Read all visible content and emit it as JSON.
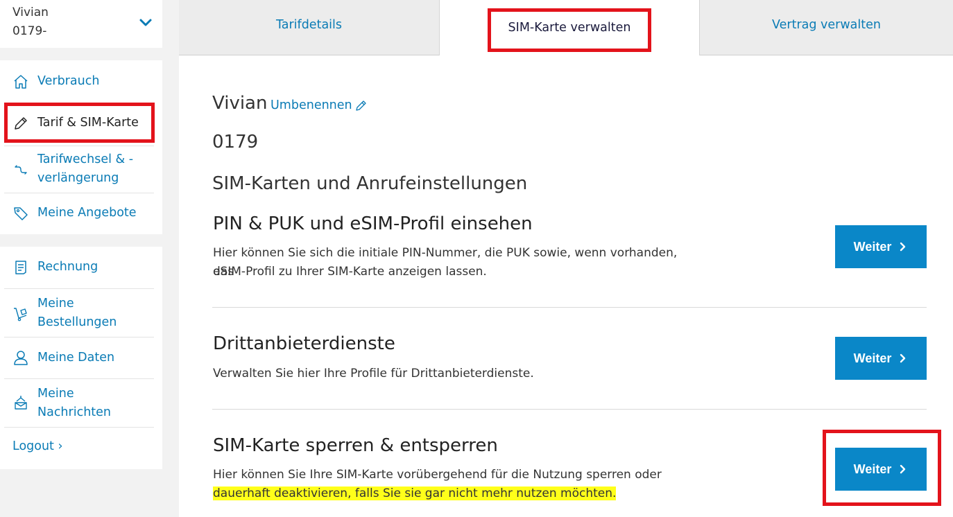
{
  "account": {
    "name": "Vivian",
    "number": "0179-"
  },
  "sidebar": {
    "group1": [
      {
        "label": "Verbrauch",
        "icon": "home-icon"
      },
      {
        "label": "Tarif & SIM-Karte",
        "icon": "pencil-icon",
        "active": true
      },
      {
        "label_line1": "Tarifwechsel & -",
        "label_line2": "verlängerung",
        "icon": "swap-icon"
      },
      {
        "label": "Meine Angebote",
        "icon": "tag-icon"
      }
    ],
    "group2": [
      {
        "label": "Rechnung",
        "icon": "invoice-icon"
      },
      {
        "label_line1": "Meine",
        "label_line2": "Bestellungen",
        "icon": "cart-icon"
      },
      {
        "label": "Meine Daten",
        "icon": "user-icon"
      },
      {
        "label_line1": "Meine",
        "label_line2": "Nachrichten",
        "icon": "mailbox-icon"
      }
    ],
    "logout": "Logout ›"
  },
  "tabs": [
    {
      "label": "Tarifdetails"
    },
    {
      "label": "SIM-Karte verwalten",
      "active": true
    },
    {
      "label": "Vertrag verwalten"
    }
  ],
  "main": {
    "name": "Vivian",
    "rename": "Umbenennen",
    "phone": "0179",
    "section_title": "SIM-Karten und Anrufeinstellungen",
    "rows": [
      {
        "title": "PIN & PUK und eSIM-Profil einsehen",
        "desc_line1": "Hier können Sie sich die initiale PIN-Nummer, die PUK sowie, wenn vorhanden, das",
        "desc_line2": "eSIM-Profil zu Ihrer SIM-Karte anzeigen lassen.",
        "button": "Weiter"
      },
      {
        "title": "Drittanbieterdienste",
        "desc_line1": "Verwalten Sie hier Ihre Profile für Drittanbieterdienste.",
        "button": "Weiter"
      },
      {
        "title": "SIM-Karte sperren & entsperren",
        "desc_line1": "Hier können Sie Ihre SIM-Karte vorübergehend für die Nutzung sperren oder",
        "desc_line2": "dauerhaft deaktivieren, falls Sie sie gar nicht mehr nutzen möchten.",
        "button": "Weiter"
      }
    ]
  },
  "colors": {
    "accent": "#0a87c8",
    "link": "#0a7bb5",
    "highlight_box": "#e3131b",
    "text_highlight": "#ffff1a"
  }
}
